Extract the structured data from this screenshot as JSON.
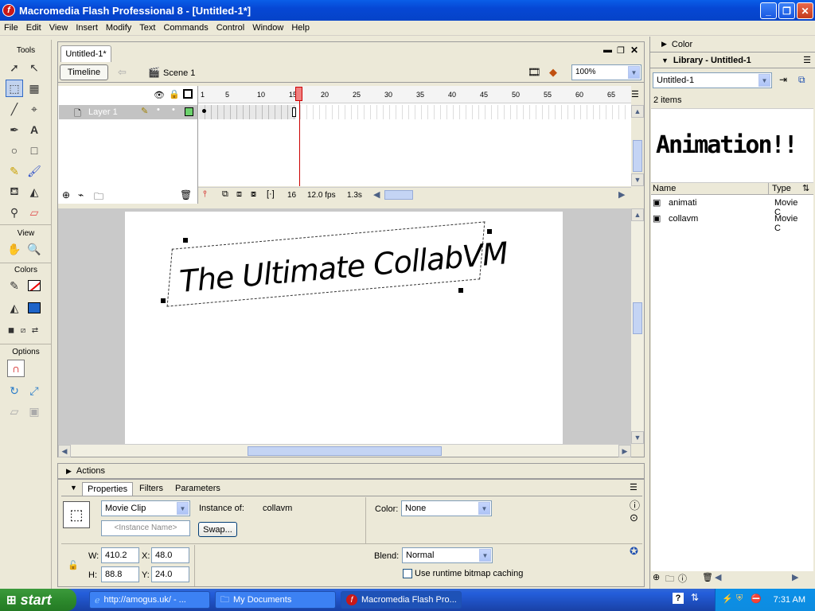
{
  "window": {
    "title": "Macromedia Flash Professional 8 - [Untitled-1*]"
  },
  "menu": [
    "File",
    "Edit",
    "View",
    "Insert",
    "Modify",
    "Text",
    "Commands",
    "Control",
    "Window",
    "Help"
  ],
  "tools_panel": {
    "title": "Tools",
    "view_label": "View",
    "colors_label": "Colors",
    "options_label": "Options"
  },
  "document": {
    "tab": "Untitled-1*",
    "timeline_btn": "Timeline",
    "scene": "Scene 1",
    "zoom": "100%"
  },
  "timeline": {
    "layer_name": "Layer 1",
    "ruler": [
      "1",
      "5",
      "10",
      "15",
      "20",
      "25",
      "30",
      "35",
      "40",
      "45",
      "50",
      "55",
      "60",
      "65"
    ],
    "current_frame": "16",
    "fps": "12.0 fps",
    "time": "1.3s"
  },
  "stage": {
    "text": "The Ultimate CollabVM"
  },
  "actions": {
    "label": "Actions"
  },
  "properties": {
    "tabs": [
      "Properties",
      "Filters",
      "Parameters"
    ],
    "symbol_type": "Movie Clip",
    "instance_name_placeholder": "<Instance Name>",
    "instance_of_label": "Instance of:",
    "instance_of": "collavm",
    "swap": "Swap...",
    "color_label": "Color:",
    "color": "None",
    "w_label": "W:",
    "w": "410.2",
    "x_label": "X:",
    "x": "48.0",
    "h_label": "H:",
    "h": "88.8",
    "y_label": "Y:",
    "y": "24.0",
    "blend_label": "Blend:",
    "blend": "Normal",
    "bitmap_caching": "Use runtime bitmap caching"
  },
  "right": {
    "color_header": "Color",
    "library_header": "Library - Untitled-1",
    "library_doc": "Untitled-1",
    "item_count": "2 items",
    "preview_text": "Animation!!",
    "col_name": "Name",
    "col_type": "Type",
    "items": [
      {
        "name": "animati",
        "type": "Movie C"
      },
      {
        "name": "collavm",
        "type": "Movie C"
      }
    ]
  },
  "taskbar": {
    "start": "start",
    "tasks": [
      "http://amogus.uk/ - ...",
      "My Documents",
      "Macromedia Flash Pro..."
    ],
    "clock": "7:31 AM"
  }
}
